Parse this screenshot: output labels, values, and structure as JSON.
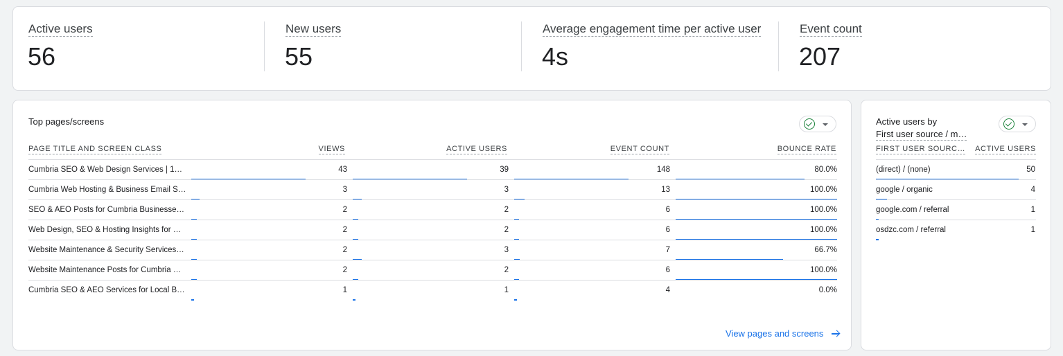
{
  "metrics": [
    {
      "label": "Active users",
      "value": "56"
    },
    {
      "label": "New users",
      "value": "55"
    },
    {
      "label": "Average engagement time per active user",
      "value": "4s"
    },
    {
      "label": "Event count",
      "value": "207"
    }
  ],
  "pages_card": {
    "title": "Top pages/screens",
    "columns": [
      "PAGE TITLE AND SCREEN CLASS",
      "VIEWS",
      "ACTIVE USERS",
      "EVENT COUNT",
      "BOUNCE RATE"
    ],
    "rows": [
      {
        "title": "Cumbria SEO & Web Design Services | 14…",
        "views": "43",
        "users": "39",
        "events": "148",
        "bounce": "80.0%",
        "views_frac": 1.0,
        "users_frac": 1.0,
        "events_frac": 1.0,
        "bounce_frac": 0.8
      },
      {
        "title": "Cumbria Web Hosting & Business Email S…",
        "views": "3",
        "users": "3",
        "events": "13",
        "bounce": "100.0%",
        "views_frac": 0.07,
        "users_frac": 0.077,
        "events_frac": 0.088,
        "bounce_frac": 1.0
      },
      {
        "title": "SEO & AEO Posts for Cumbria Businesse…",
        "views": "2",
        "users": "2",
        "events": "6",
        "bounce": "100.0%",
        "views_frac": 0.047,
        "users_frac": 0.051,
        "events_frac": 0.041,
        "bounce_frac": 1.0
      },
      {
        "title": "Web Design, SEO & Hosting Insights for C…",
        "views": "2",
        "users": "2",
        "events": "6",
        "bounce": "100.0%",
        "views_frac": 0.047,
        "users_frac": 0.051,
        "events_frac": 0.041,
        "bounce_frac": 1.0
      },
      {
        "title": "Website Maintenance & Security Services…",
        "views": "2",
        "users": "3",
        "events": "7",
        "bounce": "66.7%",
        "views_frac": 0.047,
        "users_frac": 0.077,
        "events_frac": 0.047,
        "bounce_frac": 0.667
      },
      {
        "title": "Website Maintenance Posts for Cumbria …",
        "views": "2",
        "users": "2",
        "events": "6",
        "bounce": "100.0%",
        "views_frac": 0.047,
        "users_frac": 0.051,
        "events_frac": 0.041,
        "bounce_frac": 1.0
      },
      {
        "title": "Cumbria SEO & AEO Services for Local B…",
        "views": "1",
        "users": "1",
        "events": "4",
        "bounce": "0.0%",
        "views_frac": 0.023,
        "users_frac": 0.026,
        "events_frac": 0.027,
        "bounce_frac": 0.0
      }
    ],
    "link_label": "View pages and screens"
  },
  "sources_card": {
    "title_line1": "Active users by",
    "title_line2": "First user source / m…",
    "columns": [
      "FIRST USER SOURC…",
      "ACTIVE USERS"
    ],
    "rows": [
      {
        "source": "(direct) / (none)",
        "users": "50",
        "frac": 1.0
      },
      {
        "source": "google / organic",
        "users": "4",
        "frac": 0.08
      },
      {
        "source": "google.com / referral",
        "users": "1",
        "frac": 0.02
      },
      {
        "source": "osdzc.com / referral",
        "users": "1",
        "frac": 0.02
      }
    ]
  },
  "colors": {
    "bar": "#1a73e8",
    "check": "#188038",
    "link": "#1a73e8"
  }
}
